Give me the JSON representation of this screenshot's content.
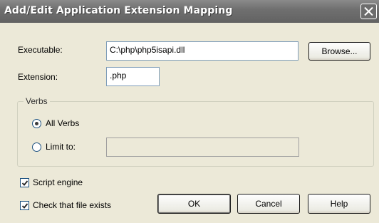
{
  "window": {
    "title": "Add/Edit Application Extension Mapping",
    "close_icon": "close-icon"
  },
  "form": {
    "executable_label": "Executable:",
    "executable_value": "C:\\php\\php5isapi.dll",
    "browse_label": "Browse...",
    "extension_label": "Extension:",
    "extension_value": ".php"
  },
  "verbs": {
    "group_label": "Verbs",
    "all_verbs_label": "All Verbs",
    "all_verbs_selected": true,
    "limit_to_label": "Limit to:",
    "limit_to_value": ""
  },
  "options": {
    "script_engine_label": "Script engine",
    "script_engine_checked": true,
    "check_file_label": "Check that file exists",
    "check_file_checked": true
  },
  "buttons": {
    "ok_label": "OK",
    "cancel_label": "Cancel",
    "help_label": "Help"
  }
}
